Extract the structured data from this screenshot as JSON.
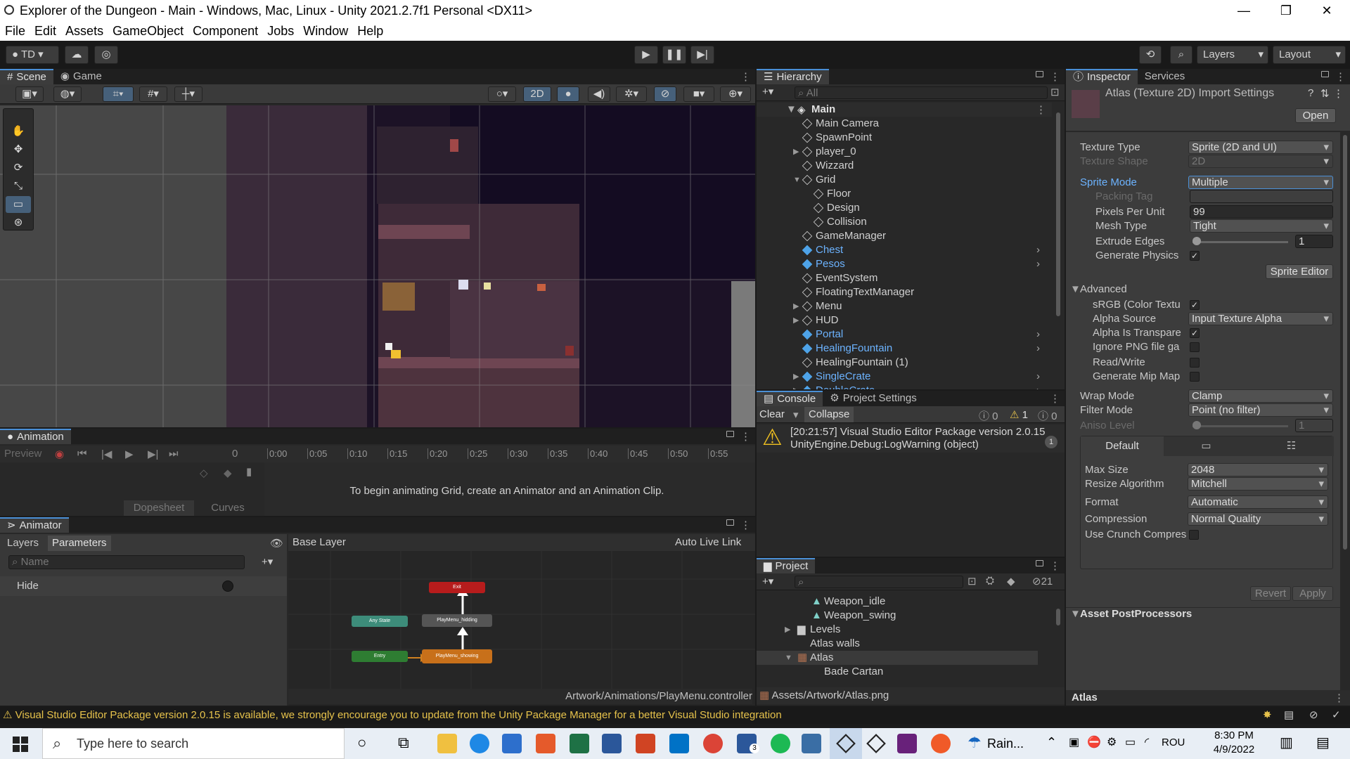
{
  "window": {
    "title": "Explorer of the Dungeon - Main - Windows, Mac, Linux - Unity 2021.2.7f1 Personal <DX11>",
    "min": "—",
    "restore": "❐",
    "close": "✕"
  },
  "menu": [
    "File",
    "Edit",
    "Assets",
    "GameObject",
    "Component",
    "Jobs",
    "Window",
    "Help"
  ],
  "toolbar": {
    "account": "TD",
    "layers": "Layers",
    "layout": "Layout"
  },
  "scene_tabs": {
    "scene": "Scene",
    "game": "Game",
    "mode_2d": "2D"
  },
  "hierarchy": {
    "tab": "Hierarchy",
    "search_placeholder": "All",
    "root": "Main",
    "items": [
      {
        "label": "Main Camera",
        "indent": 1,
        "prefab": false
      },
      {
        "label": "SpawnPoint",
        "indent": 1,
        "prefab": false
      },
      {
        "label": "player_0",
        "indent": 1,
        "prefab": false,
        "arrow": "▶"
      },
      {
        "label": "Wizzard",
        "indent": 1,
        "prefab": false
      },
      {
        "label": "Grid",
        "indent": 1,
        "prefab": false,
        "arrow": "▼"
      },
      {
        "label": "Floor",
        "indent": 2,
        "prefab": false
      },
      {
        "label": "Design",
        "indent": 2,
        "prefab": false
      },
      {
        "label": "Collision",
        "indent": 2,
        "prefab": false
      },
      {
        "label": "GameManager",
        "indent": 1,
        "prefab": false
      },
      {
        "label": "Chest",
        "indent": 1,
        "prefab": true
      },
      {
        "label": "Pesos",
        "indent": 1,
        "prefab": true
      },
      {
        "label": "EventSystem",
        "indent": 1,
        "prefab": false
      },
      {
        "label": "FloatingTextManager",
        "indent": 1,
        "prefab": false
      },
      {
        "label": "Menu",
        "indent": 1,
        "prefab": false,
        "arrow": "▶"
      },
      {
        "label": "HUD",
        "indent": 1,
        "prefab": false,
        "arrow": "▶"
      },
      {
        "label": "Portal",
        "indent": 1,
        "prefab": true
      },
      {
        "label": "HealingFountain",
        "indent": 1,
        "prefab": true
      },
      {
        "label": "HealingFountain (1)",
        "indent": 1,
        "prefab": false
      },
      {
        "label": "SingleCrate",
        "indent": 1,
        "prefab": true,
        "arrow": "▶"
      },
      {
        "label": "DoubleCrate",
        "indent": 1,
        "prefab": true,
        "arrow": "▶"
      }
    ]
  },
  "console": {
    "tab": "Console",
    "tab2": "Project Settings",
    "clear": "Clear",
    "collapse": "Collapse",
    "counts": {
      "info": "0",
      "warn": "1",
      "error": "0"
    },
    "message_line1": "[20:21:57] Visual Studio Editor Package version 2.0.15",
    "message_line2": "UnityEngine.Debug:LogWarning (object)",
    "message_count": "1"
  },
  "inspector": {
    "tab": "Inspector",
    "tab2": "Services",
    "header": "Atlas (Texture 2D) Import Settings",
    "open": "Open",
    "texture_type": {
      "label": "Texture Type",
      "value": "Sprite (2D and UI)"
    },
    "texture_shape": {
      "label": "Texture Shape",
      "value": "2D"
    },
    "sprite_mode": {
      "label": "Sprite Mode",
      "value": "Multiple"
    },
    "packing_tag": {
      "label": "Packing Tag",
      "value": ""
    },
    "ppu": {
      "label": "Pixels Per Unit",
      "value": "99"
    },
    "mesh_type": {
      "label": "Mesh Type",
      "value": "Tight"
    },
    "extrude": {
      "label": "Extrude Edges",
      "value": "1"
    },
    "gen_physics": {
      "label": "Generate Physics",
      "checked": "✓"
    },
    "sprite_editor": "Sprite Editor",
    "advanced": "Advanced",
    "srgb": {
      "label": "sRGB (Color Textu",
      "checked": "✓"
    },
    "alpha_source": {
      "label": "Alpha Source",
      "value": "Input Texture Alpha"
    },
    "alpha_transp": {
      "label": "Alpha Is Transpare",
      "checked": "✓"
    },
    "ignore_png": {
      "label": "Ignore PNG file ga",
      "checked": ""
    },
    "read_write": {
      "label": "Read/Write",
      "checked": ""
    },
    "gen_mip": {
      "label": "Generate Mip Map",
      "checked": ""
    },
    "wrap_mode": {
      "label": "Wrap Mode",
      "value": "Clamp"
    },
    "filter_mode": {
      "label": "Filter Mode",
      "value": "Point (no filter)"
    },
    "aniso": {
      "label": "Aniso Level",
      "value": "1"
    },
    "platform_tab": "Default",
    "max_size": {
      "label": "Max Size",
      "value": "2048"
    },
    "resize": {
      "label": "Resize Algorithm",
      "value": "Mitchell"
    },
    "format": {
      "label": "Format",
      "value": "Automatic"
    },
    "compression": {
      "label": "Compression",
      "value": "Normal Quality"
    },
    "crunch": {
      "label": "Use Crunch Compres",
      "checked": ""
    },
    "revert": "Revert",
    "apply": "Apply",
    "postprocessors": "Asset PostProcessors",
    "preview_name": "Atlas"
  },
  "animation": {
    "tab": "Animation",
    "preview": "Preview",
    "frame": "0",
    "ticks": [
      "0:00",
      "0:05",
      "0:10",
      "0:15",
      "0:20",
      "0:25",
      "0:30",
      "0:35",
      "0:40",
      "0:45",
      "0:50",
      "0:55"
    ],
    "message": "To begin animating Grid, create an Animator and an Animation Clip.",
    "dopesheet": "Dopesheet",
    "curves": "Curves"
  },
  "animator": {
    "tab": "Animator",
    "layers": "Layers",
    "parameters": "Parameters",
    "name_placeholder": "Name",
    "param": "Hide",
    "base_layer": "Base Layer",
    "auto_live": "Auto Live Link",
    "nodes": {
      "exit": "Exit",
      "any": "Any State",
      "entry": "Entry",
      "hidding": "PlayMenu_hidding",
      "showing": "PlayMenu_showing"
    },
    "path": "Artwork/Animations/PlayMenu.controller"
  },
  "project": {
    "tab": "Project",
    "count": "21",
    "items": [
      {
        "label": "Weapon_idle",
        "indent": 3,
        "type": "anim"
      },
      {
        "label": "Weapon_swing",
        "indent": 3,
        "type": "anim"
      },
      {
        "label": "Levels",
        "indent": 2,
        "type": "folder",
        "arrow": "▶"
      },
      {
        "label": "Atlas walls",
        "indent": 2,
        "type": "plain"
      },
      {
        "label": "Atlas",
        "indent": 2,
        "type": "atlas",
        "arrow": "▼",
        "selected": true
      },
      {
        "label": "Bade Cartan",
        "indent": 3,
        "type": "plain"
      }
    ],
    "path": "Assets/Artwork/Atlas.png"
  },
  "status": {
    "message": "Visual Studio Editor Package version 2.0.15 is available, we strongly encourage you to update from the Unity Package Manager for a better Visual Studio integration"
  },
  "taskbar": {
    "search": "Type here to search",
    "weather": "Rain...",
    "lang": "ROU",
    "time": "8:30 PM",
    "date": "4/9/2022",
    "badge": "3"
  },
  "colors": {
    "accent": "#4a8fd6",
    "prefab": "#6cb3ff",
    "warning": "#e6c24b",
    "exit": "#b71c1c",
    "any": "#3d8c7a",
    "entry": "#2e7d32",
    "state": "#555555",
    "default_state": "#c8701a"
  }
}
